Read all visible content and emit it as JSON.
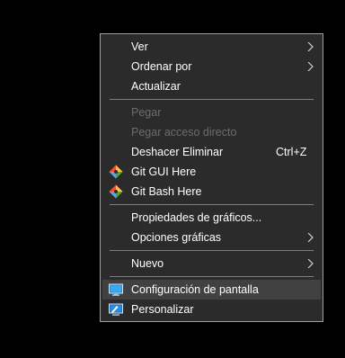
{
  "menu": {
    "items": {
      "ver": {
        "label": "Ver"
      },
      "ordenar": {
        "label": "Ordenar por"
      },
      "actualizar": {
        "label": "Actualizar"
      },
      "pegar": {
        "label": "Pegar"
      },
      "pegar_acceso": {
        "label": "Pegar acceso directo"
      },
      "deshacer": {
        "label": "Deshacer Eliminar",
        "shortcut": "Ctrl+Z"
      },
      "git_gui": {
        "label": "Git GUI Here",
        "icon": "git-icon"
      },
      "git_bash": {
        "label": "Git Bash Here",
        "icon": "git-icon"
      },
      "propiedades": {
        "label": "Propiedades de gráficos..."
      },
      "opciones": {
        "label": "Opciones gráficas"
      },
      "nuevo": {
        "label": "Nuevo"
      },
      "configuracion": {
        "label": "Configuración de pantalla",
        "icon": "display-icon"
      },
      "personalizar": {
        "label": "Personalizar",
        "icon": "personalize-icon"
      }
    }
  },
  "colors": {
    "background": "#000000",
    "menu_bg": "#2b2b2b",
    "hover_bg": "#414141",
    "text": "#ffffff",
    "disabled_text": "#6d6d6d"
  }
}
